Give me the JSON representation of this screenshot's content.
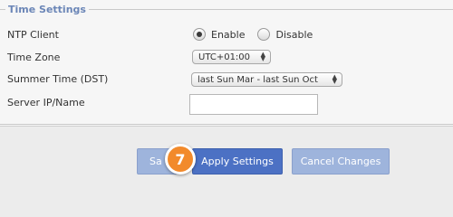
{
  "section": {
    "title": "Time Settings"
  },
  "rows": {
    "ntp_label": "NTP Client",
    "ntp_options": {
      "enable": "Enable",
      "disable": "Disable",
      "selected": "Enable"
    },
    "timezone_label": "Time Zone",
    "timezone_value": "UTC+01:00",
    "dst_label": "Summer Time (DST)",
    "dst_value": "last Sun Mar - last Sun Oct",
    "server_label": "Server IP/Name",
    "server_value": ""
  },
  "buttons": {
    "save_partial": "Sa",
    "apply": "Apply Settings",
    "cancel": "Cancel Changes"
  },
  "callout": {
    "step": "7",
    "color": "#f28a2b"
  },
  "colors": {
    "legend": "#6b86b7",
    "primary_button": "#4c71c4",
    "secondary_button": "#9eb4dc"
  }
}
